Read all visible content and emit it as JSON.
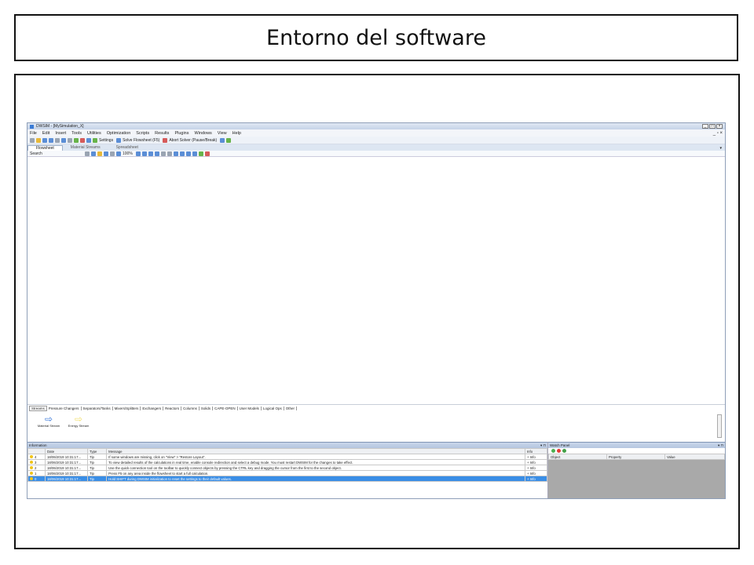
{
  "slide_title": "Entorno del software",
  "window": {
    "title": "DWSIM - [MySimulation_X]",
    "menu": [
      "File",
      "Edit",
      "Insert",
      "Tools",
      "Utilities",
      "Optimization",
      "Scripts",
      "Results",
      "Plugins",
      "Windows",
      "View",
      "Help"
    ],
    "toolbar": {
      "settings_label": "Settings",
      "solve_label": "Solve Flowsheet (F5)",
      "abort_label": "Abort Solver (Pause/Break)"
    },
    "tabs": [
      "Flowsheet",
      "Material Streams",
      "Spreadsheet"
    ],
    "search_label": "Search",
    "zoom": "100%"
  },
  "palette": {
    "tabs": [
      "Streams",
      "Pressure Changers",
      "Separators/Tanks",
      "Mixers/Splitters",
      "Exchangers",
      "Reactors",
      "Columns",
      "Solids",
      "CAPE-OPEN",
      "User Models",
      "Logical Ops",
      "Other"
    ],
    "items": [
      {
        "label": "Material Stream",
        "icon": "blue-arrow-icon"
      },
      {
        "label": "Energy Stream",
        "icon": "yellow-arrow-icon"
      }
    ]
  },
  "information": {
    "title": "Information",
    "columns": [
      "",
      "Date",
      "Type",
      "Message",
      "Info"
    ],
    "rows": [
      {
        "n": "4",
        "date": "18/06/2019 10:31:17...",
        "type": "Tip",
        "message": "If some windows are missing, click on \"View\" > \"Restore Layout\".",
        "info": "+ Info"
      },
      {
        "n": "3",
        "date": "18/06/2019 10:31:17...",
        "type": "Tip",
        "message": "To view detailed results of the calculations in real time, enable console redirection and select a debug mode. You must restart DWSIM for the changes to take effect.",
        "info": "+ Info"
      },
      {
        "n": "2",
        "date": "18/06/2019 10:31:17...",
        "type": "Tip",
        "message": "Use the quick connection tool on the toolbar to quickly connect objects by pressing the CTRL key and dragging the cursor from the first to the second object.",
        "info": "+ Info"
      },
      {
        "n": "1",
        "date": "18/06/2019 10:31:17...",
        "type": "Tip",
        "message": "Press F5 on any area inside the flowsheet to start a full calculation.",
        "info": "+ Info"
      },
      {
        "n": "0",
        "date": "18/06/2019 10:31:17...",
        "type": "Tip",
        "message": "Hold SHIFT during DWSIM initialization to reset the settings to their default values.",
        "info": "+ Info"
      }
    ]
  },
  "watch_panel": {
    "title": "Watch Panel",
    "columns": [
      "Object",
      "Property",
      "Value"
    ]
  }
}
